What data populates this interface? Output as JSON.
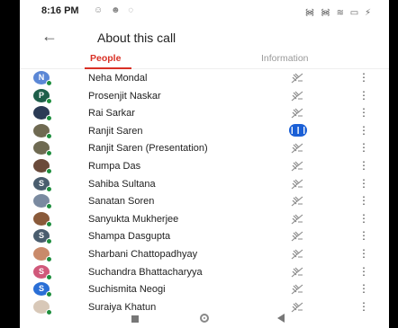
{
  "status": {
    "time": "8:16 PM",
    "notifications": "☺ ☻ ◌",
    "right": "᯼ ᯼ ≋ ▭ ⚡"
  },
  "header": {
    "back_icon": "arrow-back-icon",
    "title": "About this call"
  },
  "tabs": {
    "people": "People",
    "information": "Information"
  },
  "participants": [
    {
      "name": "Neha Mondal",
      "avatar": "N",
      "color": "#5b87d6",
      "mic": "muted"
    },
    {
      "name": "Prosenjit Naskar",
      "avatar": "P",
      "color": "#1e5f4a",
      "mic": "muted"
    },
    {
      "name": "Rai Sarkar",
      "avatar": "",
      "color": "#2b3b55",
      "mic": "muted"
    },
    {
      "name": "Ranjit Saren",
      "avatar": "",
      "color": "#6f6a52",
      "mic": "active"
    },
    {
      "name": "Ranjit Saren (Presentation)",
      "avatar": "",
      "color": "#6f6a52",
      "mic": "muted"
    },
    {
      "name": "Rumpa Das",
      "avatar": "",
      "color": "#6a4a3a",
      "mic": "muted"
    },
    {
      "name": "Sahiba Sultana",
      "avatar": "S",
      "color": "#4a5d6e",
      "mic": "muted"
    },
    {
      "name": "Sanatan Soren",
      "avatar": "",
      "color": "#7a8aa0",
      "mic": "muted"
    },
    {
      "name": "Sanyukta Mukherjee",
      "avatar": "",
      "color": "#8a5a3a",
      "mic": "muted"
    },
    {
      "name": "Shampa Dasgupta",
      "avatar": "S",
      "color": "#4a5d6e",
      "mic": "muted"
    },
    {
      "name": "Sharbani Chattopadhyay",
      "avatar": "",
      "color": "#c98a6a",
      "mic": "muted"
    },
    {
      "name": "Suchandra Bhattacharyya",
      "avatar": "S",
      "color": "#d0587a",
      "mic": "muted"
    },
    {
      "name": "Suchismita Neogi",
      "avatar": "S",
      "color": "#2a6fd6",
      "mic": "muted"
    },
    {
      "name": "Suraiya Khatun",
      "avatar": "",
      "color": "#d8c8b8",
      "mic": "muted"
    }
  ],
  "colors": {
    "accent": "#d93025",
    "mic_active": "#1a5fd6",
    "online_dot": "#1e8e3e"
  }
}
